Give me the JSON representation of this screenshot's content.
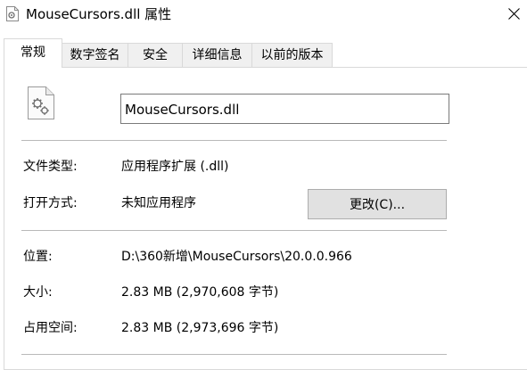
{
  "window": {
    "title": "MouseCursors.dll 属性",
    "icon": "dll-file-icon",
    "close_icon": "close-icon"
  },
  "tabs": [
    {
      "label": "常规",
      "active": true
    },
    {
      "label": "数字签名",
      "active": false
    },
    {
      "label": "安全",
      "active": false
    },
    {
      "label": "详细信息",
      "active": false
    },
    {
      "label": "以前的版本",
      "active": false
    }
  ],
  "general": {
    "file_icon": "settings-file-icon",
    "file_name": "MouseCursors.dll",
    "rows": [
      {
        "label": "文件类型:",
        "value": "应用程序扩展 (.dll)"
      },
      {
        "label": "打开方式:",
        "value": "未知应用程序"
      },
      {
        "label": "位置:",
        "value": "D:\\360新增\\MouseCursors\\20.0.0.966"
      },
      {
        "label": "大小:",
        "value": "2.83 MB (2,970,608 字节)"
      },
      {
        "label": "占用空间:",
        "value": "2.83 MB (2,973,696 字节)"
      }
    ],
    "change_button": "更改(C)..."
  }
}
